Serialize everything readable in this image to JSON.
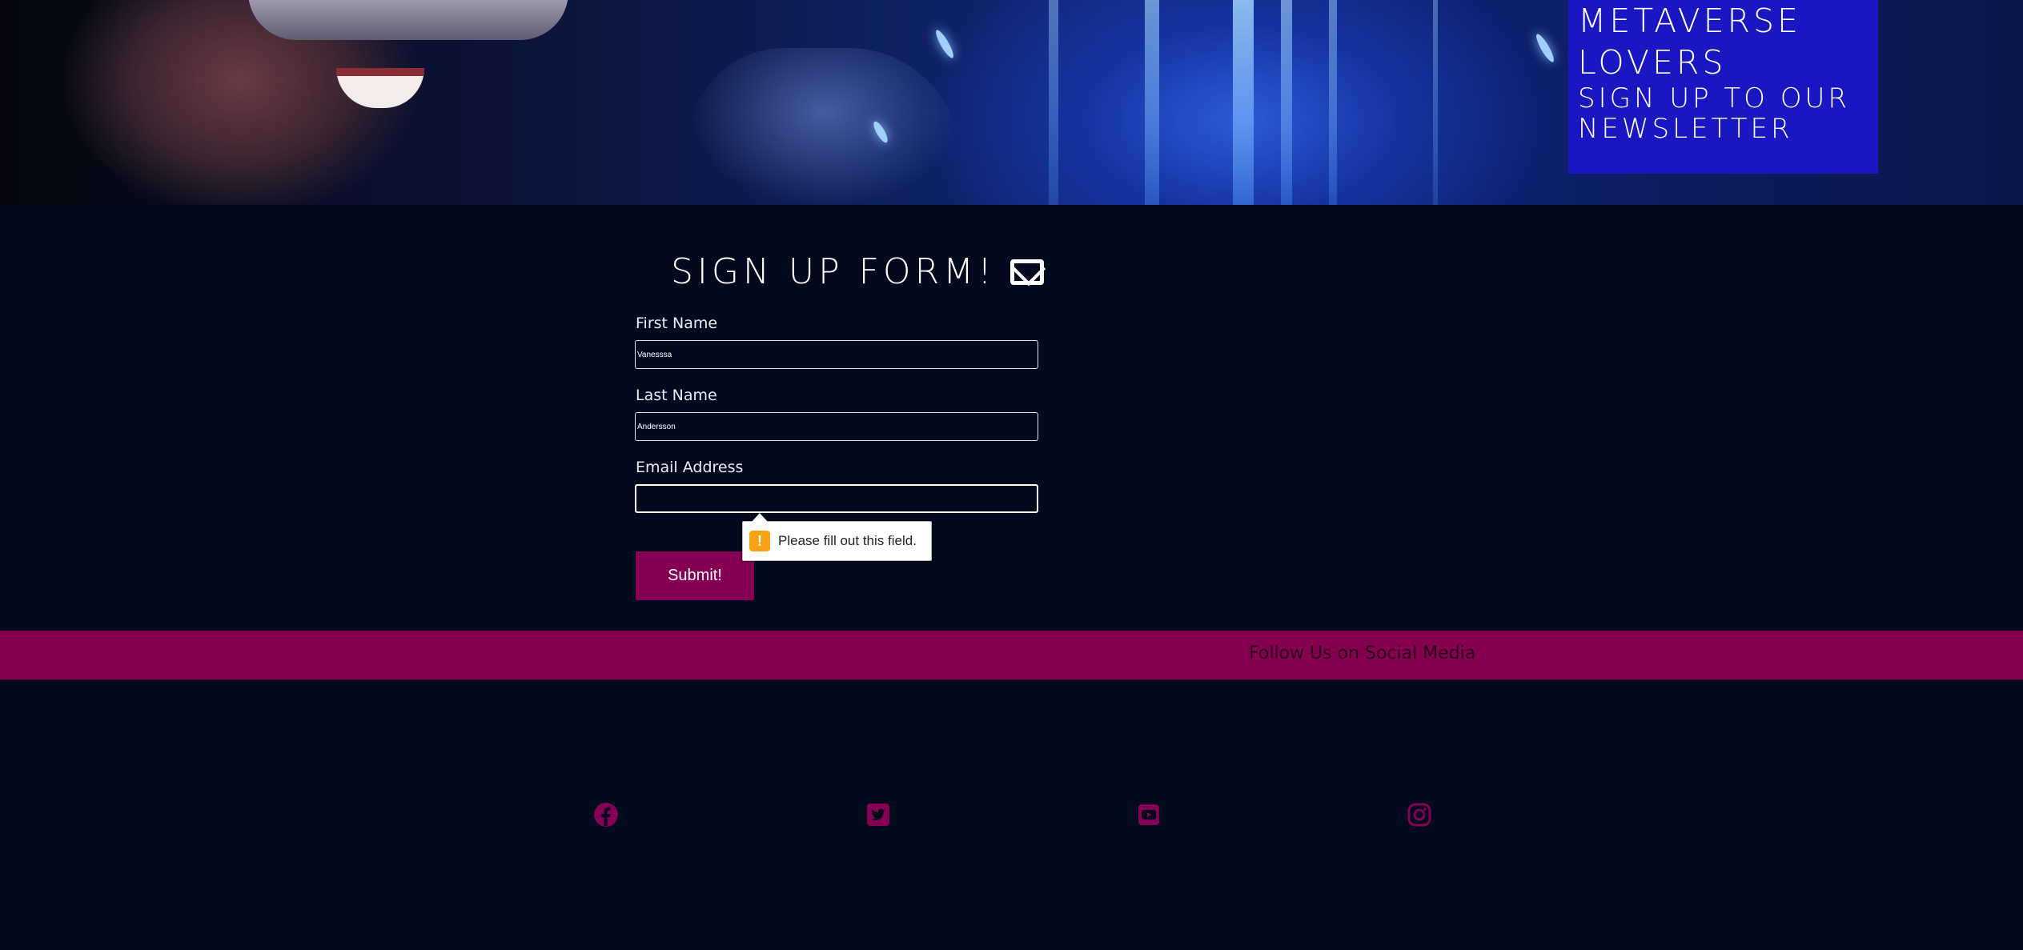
{
  "hero": {
    "heading_line1": "METAVERSE",
    "heading_line2": "LOVERS",
    "subheading_line1": "SIGN UP TO OUR",
    "subheading_line2": "NEWSLETTER"
  },
  "form": {
    "title": "SIGN UP FORM!",
    "title_icon": "envelope-icon",
    "first_name_label": "First Name",
    "first_name_value": "Vanesssa",
    "last_name_label": "Last Name",
    "last_name_value": "Andersson",
    "email_label": "Email Address",
    "email_value": "",
    "validation_message": "Please fill out this field.",
    "submit_label": "Submit!"
  },
  "social": {
    "heading": "Follow Us on Social Media",
    "icons": [
      "facebook-icon",
      "twitter-icon",
      "youtube-icon",
      "instagram-icon"
    ]
  },
  "colors": {
    "page_background": "#020b1d",
    "accent": "#850055",
    "newsletter_box": "#1a16c2",
    "warning": "#f9a216"
  }
}
